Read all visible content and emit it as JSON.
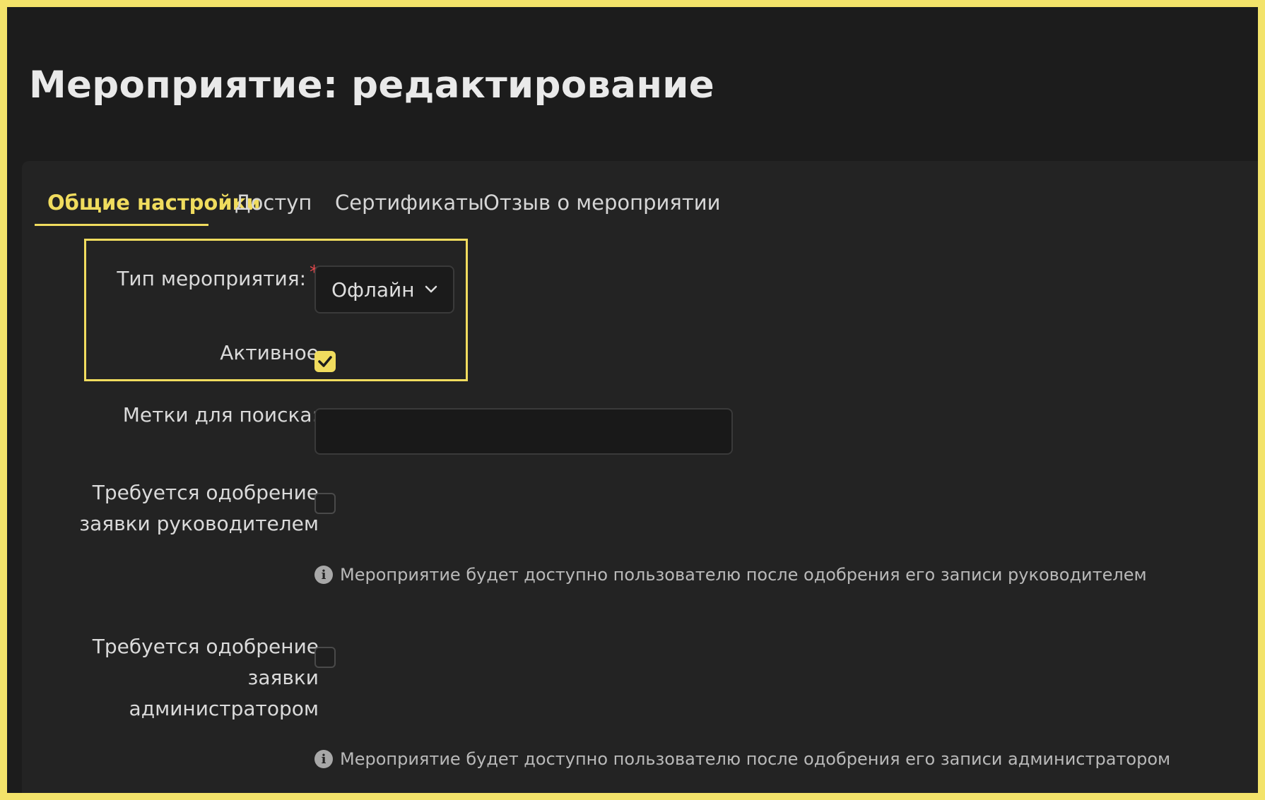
{
  "page": {
    "title": "Мероприятие: редактирование"
  },
  "tabs": [
    {
      "label": "Общие настройки",
      "active": true
    },
    {
      "label": "Доступ",
      "active": false
    },
    {
      "label": "Сертификаты",
      "active": false
    },
    {
      "label": "Отзыв о мероприятии",
      "active": false
    }
  ],
  "form": {
    "event_type": {
      "label": "Тип мероприятия:",
      "required_mark": "*",
      "value": "Офлайн",
      "icon": "chevron-down-icon"
    },
    "active": {
      "label": "Активное",
      "checked": true
    },
    "search_tags": {
      "label": "Метки для поиска:",
      "value": ""
    },
    "manager_approval": {
      "label_line1": "Требуется одобрение",
      "label_line2": "заявки руководителем",
      "checked": false,
      "hint": "Мероприятие будет доступно пользователю после одобрения его записи руководителем"
    },
    "admin_approval": {
      "label_line1": "Требуется одобрение",
      "label_line2": "заявки",
      "label_line3": "администратором",
      "checked": false,
      "hint": "Мероприятие будет доступно пользователю после одобрения его записи администратором"
    }
  },
  "colors": {
    "accent": "#f0dc5e",
    "background": "#1c1c1c",
    "panel": "#232323",
    "required": "#e5484d"
  }
}
